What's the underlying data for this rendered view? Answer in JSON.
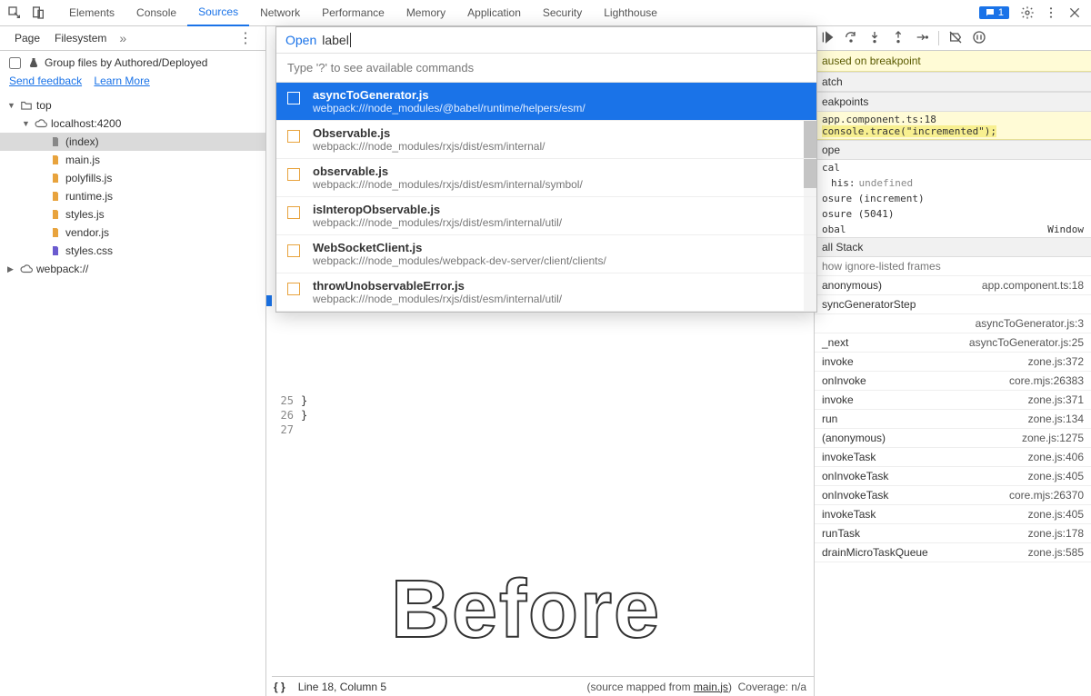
{
  "top_tabs": [
    "Elements",
    "Console",
    "Sources",
    "Network",
    "Performance",
    "Memory",
    "Application",
    "Security",
    "Lighthouse"
  ],
  "active_top_tab": "Sources",
  "feedback_count": "1",
  "left": {
    "subtabs": [
      "Page",
      "Filesystem"
    ],
    "more_glyph": "»",
    "group_label": "Group files by Authored/Deployed",
    "send_feedback": "Send feedback",
    "learn_more": "Learn More",
    "tree": [
      {
        "indent": 0,
        "arrow": "▼",
        "type": "folder",
        "label": "top"
      },
      {
        "indent": 1,
        "arrow": "▼",
        "type": "cloud",
        "label": "localhost:4200"
      },
      {
        "indent": 2,
        "arrow": "",
        "type": "doc",
        "label": "(index)",
        "selected": true
      },
      {
        "indent": 2,
        "arrow": "",
        "type": "js",
        "label": "main.js"
      },
      {
        "indent": 2,
        "arrow": "",
        "type": "js",
        "label": "polyfills.js"
      },
      {
        "indent": 2,
        "arrow": "",
        "type": "js",
        "label": "runtime.js"
      },
      {
        "indent": 2,
        "arrow": "",
        "type": "js",
        "label": "styles.js"
      },
      {
        "indent": 2,
        "arrow": "",
        "type": "js",
        "label": "vendor.js"
      },
      {
        "indent": 2,
        "arrow": "",
        "type": "css",
        "label": "styles.css"
      },
      {
        "indent": 0,
        "arrow": "▶",
        "type": "cloud",
        "label": "webpack://"
      }
    ]
  },
  "code": {
    "lines": [
      {
        "num": "25",
        "text": "  }"
      },
      {
        "num": "26",
        "text": "}"
      },
      {
        "num": "27",
        "text": ""
      }
    ],
    "status_pos": "Line 18, Column 5",
    "source_mapped_prefix": "(source mapped from ",
    "source_mapped_file": "main.js",
    "coverage": "Coverage: n/a"
  },
  "quick_open": {
    "open_label": "Open",
    "query": "label",
    "hint": "Type '?' to see available commands",
    "items": [
      {
        "name": "asyncToGenerator.js",
        "path": "webpack:///node_modules/@babel/runtime/helpers/esm/",
        "selected": true
      },
      {
        "name": "Observable.js",
        "path": "webpack:///node_modules/rxjs/dist/esm/internal/"
      },
      {
        "name": "observable.js",
        "path": "webpack:///node_modules/rxjs/dist/esm/internal/symbol/"
      },
      {
        "name": "isInteropObservable.js",
        "path": "webpack:///node_modules/rxjs/dist/esm/internal/util/"
      },
      {
        "name": "WebSocketClient.js",
        "path": "webpack:///node_modules/webpack-dev-server/client/clients/"
      },
      {
        "name": "throwUnobservableError.js",
        "path": "webpack:///node_modules/rxjs/dist/esm/internal/util/"
      }
    ]
  },
  "debugger": {
    "pause_banner": "aused on breakpoint",
    "watch": "atch",
    "breakpoints": "eakpoints",
    "bp_file": "app.component.ts:18",
    "bp_code": "console.trace(\"incremented\");",
    "scope": "ope",
    "scope_local": "cal",
    "scope_this_label": "his:",
    "scope_this_value": "undefined",
    "scope_closure_inc": "osure (increment)",
    "scope_closure_num": "osure (5041)",
    "scope_global": "obal",
    "scope_global_value": "Window",
    "callstack": "all Stack",
    "ignore_listed": "how ignore-listed frames",
    "frames": [
      {
        "fn": "anonymous)",
        "loc": "app.component.ts:18"
      },
      {
        "fn": "syncGeneratorStep",
        "loc": ""
      },
      {
        "fn": "",
        "loc": "asyncToGenerator.js:3"
      },
      {
        "fn": "_next",
        "loc": "asyncToGenerator.js:25"
      },
      {
        "fn": "invoke",
        "loc": "zone.js:372"
      },
      {
        "fn": "onInvoke",
        "loc": "core.mjs:26383"
      },
      {
        "fn": "invoke",
        "loc": "zone.js:371"
      },
      {
        "fn": "run",
        "loc": "zone.js:134"
      },
      {
        "fn": "(anonymous)",
        "loc": "zone.js:1275"
      },
      {
        "fn": "invokeTask",
        "loc": "zone.js:406"
      },
      {
        "fn": "onInvokeTask",
        "loc": "zone.js:405"
      },
      {
        "fn": "onInvokeTask",
        "loc": "core.mjs:26370"
      },
      {
        "fn": "invokeTask",
        "loc": "zone.js:405"
      },
      {
        "fn": "runTask",
        "loc": "zone.js:178"
      },
      {
        "fn": "drainMicroTaskQueue",
        "loc": "zone.js:585"
      }
    ]
  },
  "overlay_label": "Before"
}
